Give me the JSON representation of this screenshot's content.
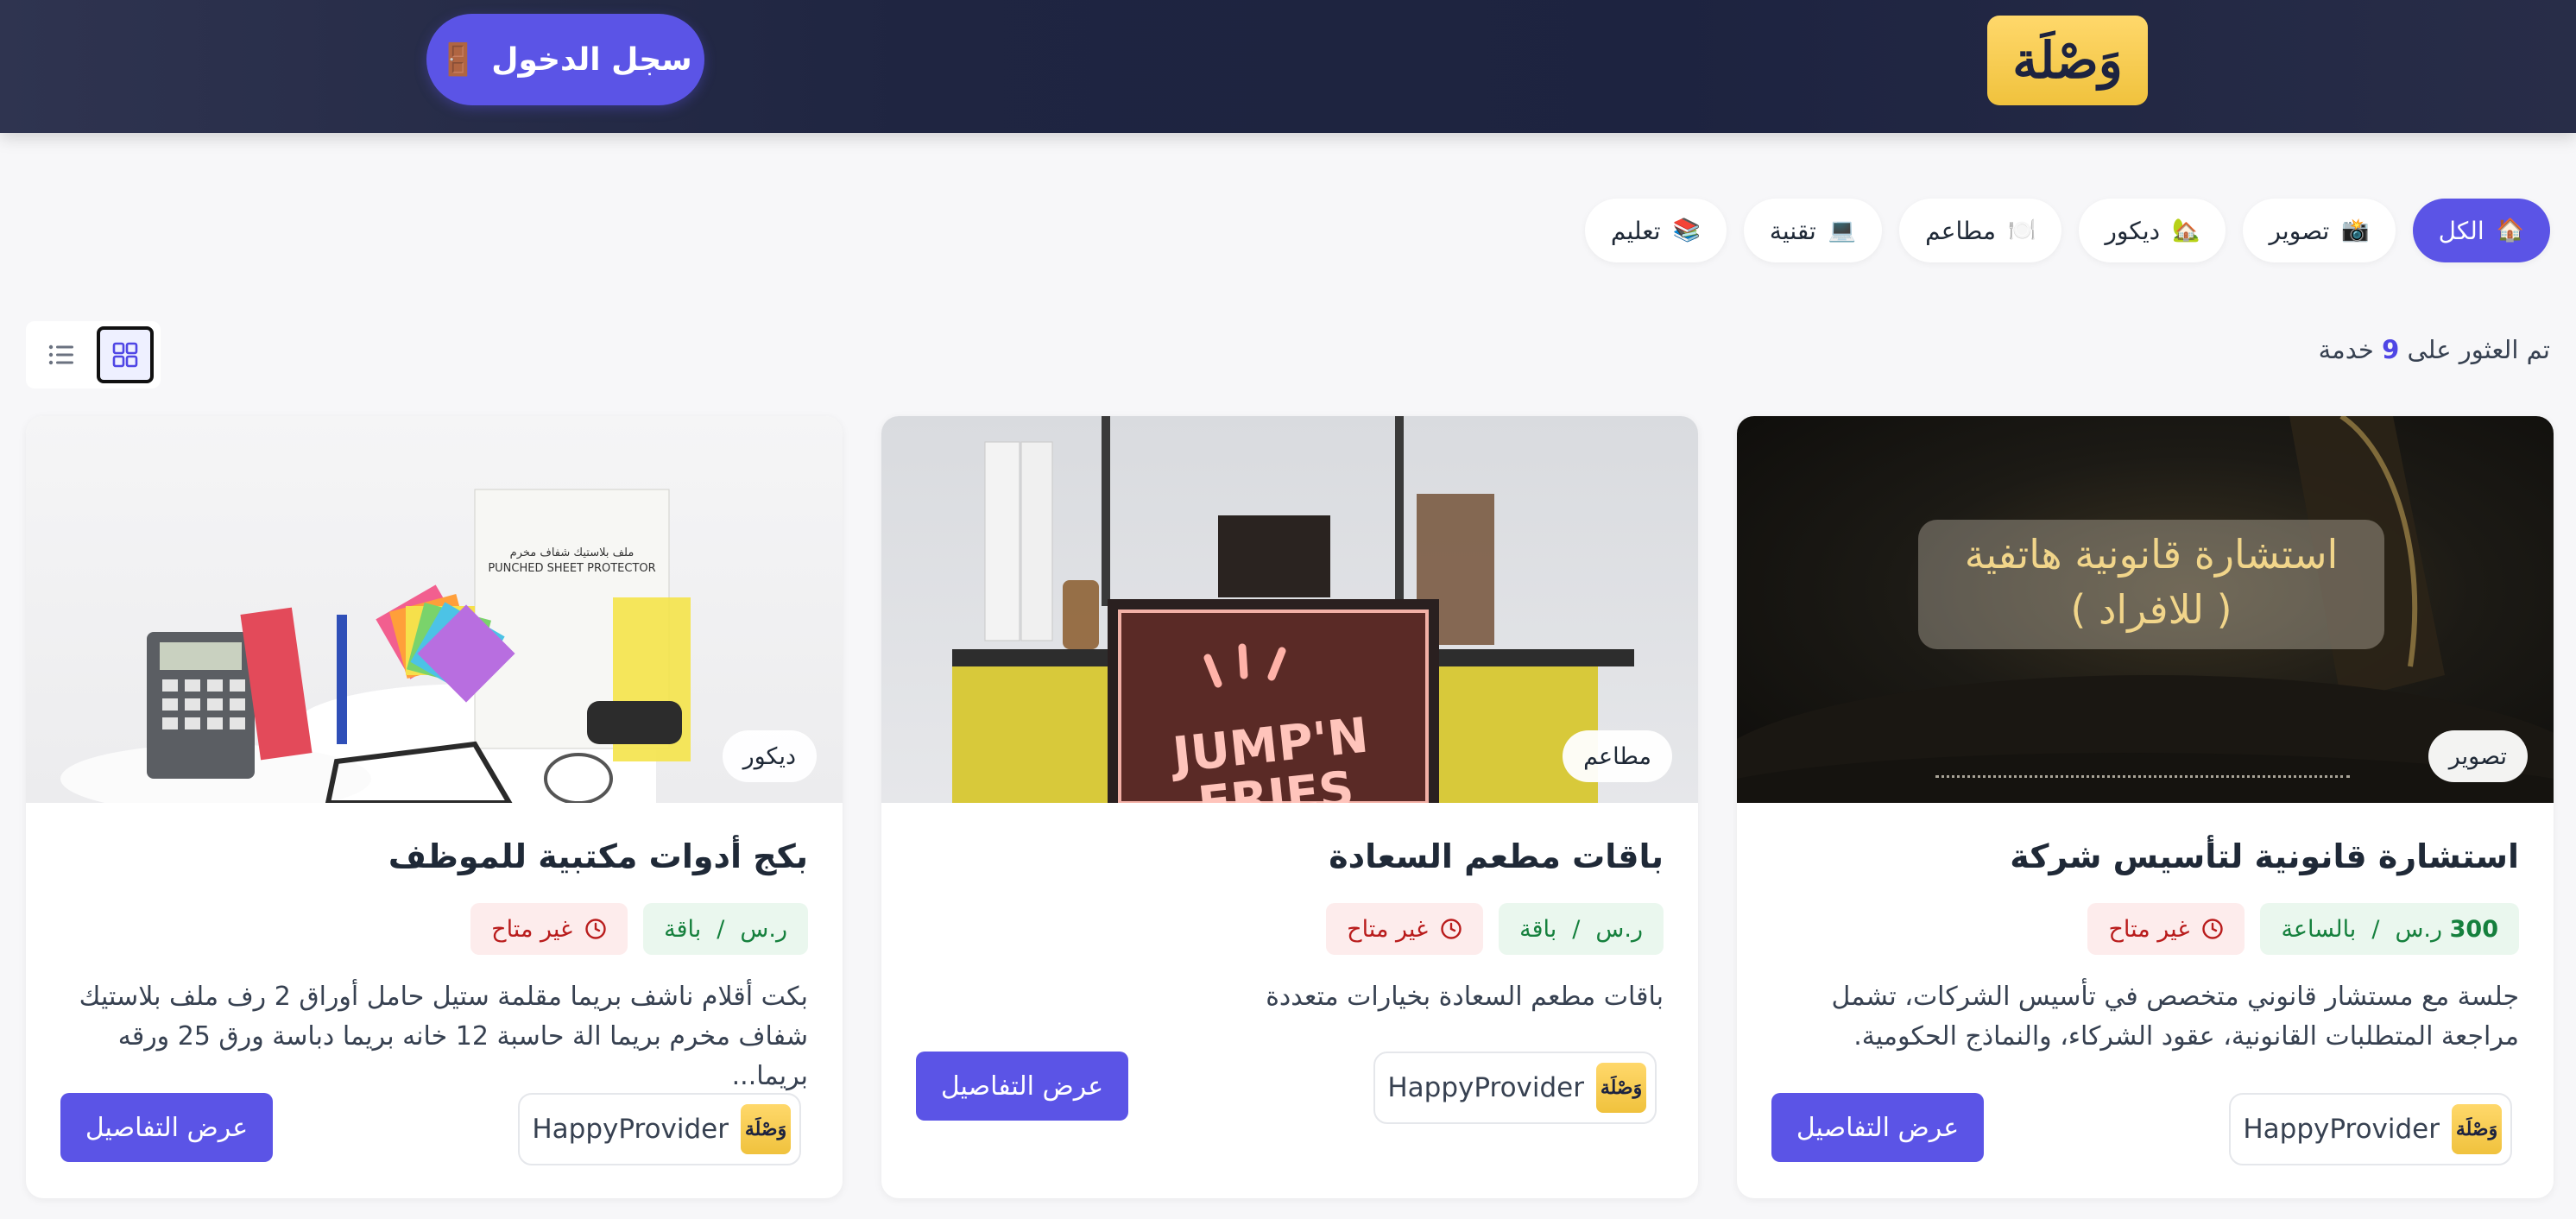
{
  "header": {
    "logo_text": "وَصْلَة",
    "login_label": "سجل الدخول"
  },
  "categories": [
    {
      "label": "الكل",
      "icon": "home-icon",
      "active": true
    },
    {
      "label": "تصوير",
      "icon": "camera-icon"
    },
    {
      "label": "ديكور",
      "icon": "house-icon"
    },
    {
      "label": "مطاعم",
      "icon": "plate-icon"
    },
    {
      "label": "تقنية",
      "icon": "laptop-icon"
    },
    {
      "label": "تعليم",
      "icon": "books-icon"
    }
  ],
  "results": {
    "prefix": "تم العثور على",
    "count": "9",
    "suffix": "خدمة"
  },
  "view_modes": [
    "grid",
    "list"
  ],
  "cards": [
    {
      "category": "تصوير",
      "image_text_line1": "استشارة قانونية هاتفية",
      "image_text_line2": "( للافراد )",
      "title": "استشارة قانونية لتأسيس شركة",
      "price_amount": "300",
      "price_currency": "ر.س",
      "price_unit": "بالساعة",
      "status": "غير متاح",
      "description": "جلسة مع مستشار قانوني متخصص في تأسيس الشركات، تشمل مراجعة المتطلبات القانونية، عقود الشركاء، والنماذج الحكومية.",
      "provider_logo": "وَصْلَة",
      "provider_name": "HappyProvider",
      "details_label": "عرض التفاصيل"
    },
    {
      "category": "مطاعم",
      "image_text_line1": "JUMP'N",
      "image_text_line2": "FRIES",
      "title": "باقات مطعم السعادة",
      "price_amount": "",
      "price_currency": "ر.س",
      "price_unit": "باقة",
      "status": "غير متاح",
      "description": "باقات مطعم السعادة بخيارات متعددة",
      "provider_logo": "وَصْلَة",
      "provider_name": "HappyProvider",
      "details_label": "عرض التفاصيل"
    },
    {
      "category": "ديكور",
      "image_text_line1": "ملف بلاستيك شفاف مخرم",
      "image_text_line2": "PUNCHED SHEET PROTECTOR",
      "title": "بكج أدوات مكتبية للموظف",
      "price_amount": "",
      "price_currency": "ر.س",
      "price_unit": "باقة",
      "status": "غير متاح",
      "description": "بكت أقلام ناشف بريما مقلمة ستيل حامل أوراق 2 رف ملف بلاستيك شفاف مخرم بريما الة حاسبة 12 خانه بريما دباسة ورق 25 ورقه بريما...",
      "provider_logo": "وَصْلَة",
      "provider_name": "HappyProvider",
      "details_label": "عرض التفاصيل"
    }
  ],
  "colors": {
    "header_bg": "#1d2340",
    "accent": "#5b54e6",
    "logo_gold": "#f0c23d",
    "price_green": "#15803d",
    "status_red": "#b91c1c"
  }
}
